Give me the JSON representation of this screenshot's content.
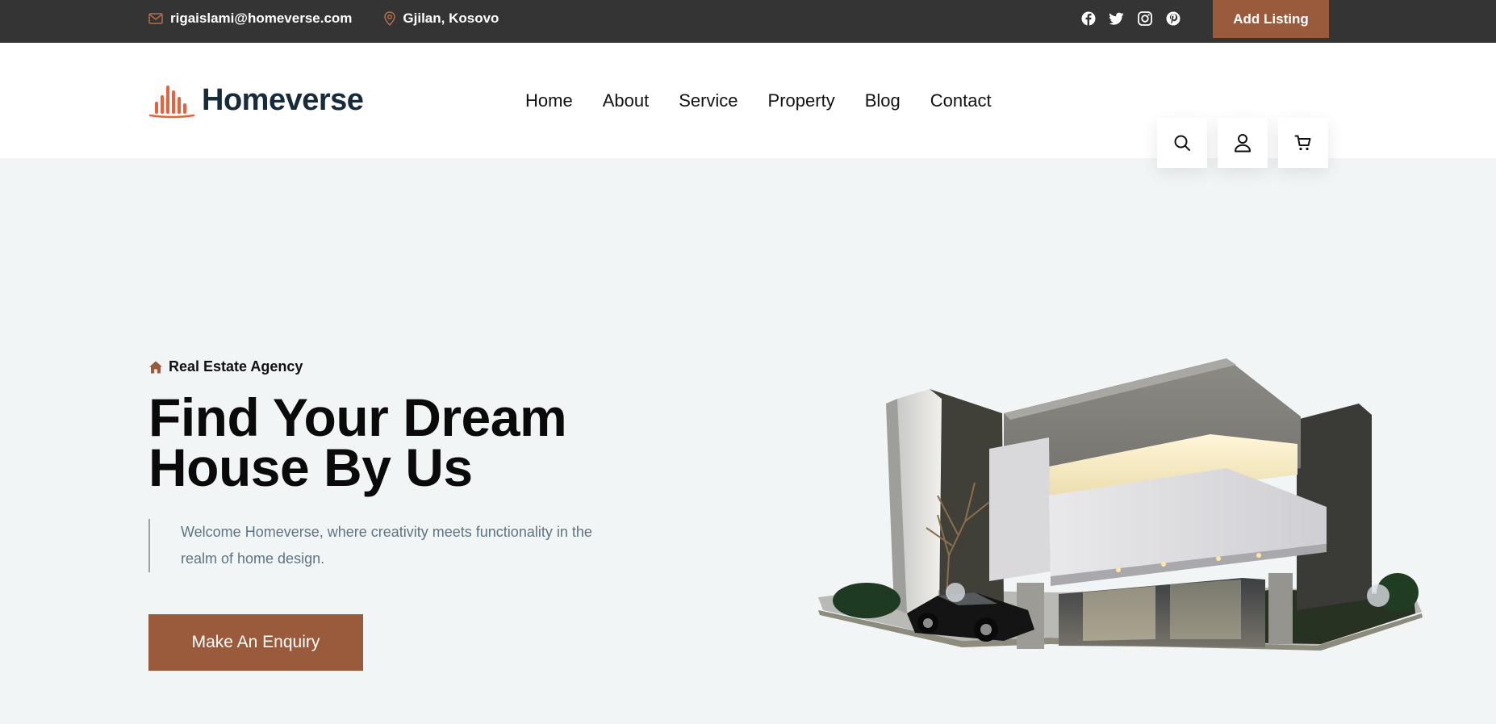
{
  "topbar": {
    "email": "rigaislami@homeverse.com",
    "location": "Gjilan, Kosovo",
    "socials": [
      "facebook-icon",
      "twitter-icon",
      "instagram-icon",
      "pinterest-icon"
    ],
    "add_listing_label": "Add Listing"
  },
  "header": {
    "logo_text": "Homeverse",
    "nav": [
      "Home",
      "About",
      "Service",
      "Property",
      "Blog",
      "Contact"
    ],
    "actions": [
      "search-icon",
      "user-icon",
      "cart-icon"
    ]
  },
  "hero": {
    "tagline": "Real Estate Agency",
    "title_line1": "Find Your Dream",
    "title_line2": "House By Us",
    "text": "Welcome Homeverse, where creativity meets functionality in the realm of home design.",
    "cta_label": "Make An Enquiry"
  },
  "colors": {
    "accent": "#9a5b3d",
    "topbar": "#343434",
    "hero_bg": "#f2f5f6",
    "logo_dark": "#172b3a",
    "logo_orange": "#e8603c"
  }
}
